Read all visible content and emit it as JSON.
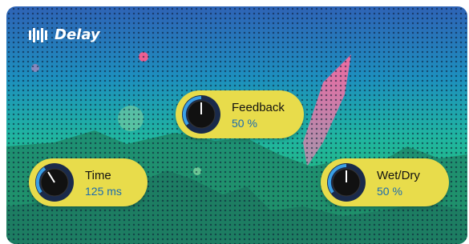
{
  "plugin": {
    "brand_icon": "presonus-logo-icon",
    "title": "Delay"
  },
  "knobs": [
    {
      "id": "feedback",
      "label": "Feedback",
      "value": "50 %",
      "level": 0.5
    },
    {
      "id": "time",
      "label": "Time",
      "value": "125 ms",
      "level": 0.3
    },
    {
      "id": "wetdry",
      "label": "Wet/Dry",
      "value": "50 %",
      "level": 0.5
    }
  ],
  "colors": {
    "pill": "#e8dc4b",
    "knob_arc": "#3aa0e6",
    "value_text": "#1a6bb0"
  }
}
